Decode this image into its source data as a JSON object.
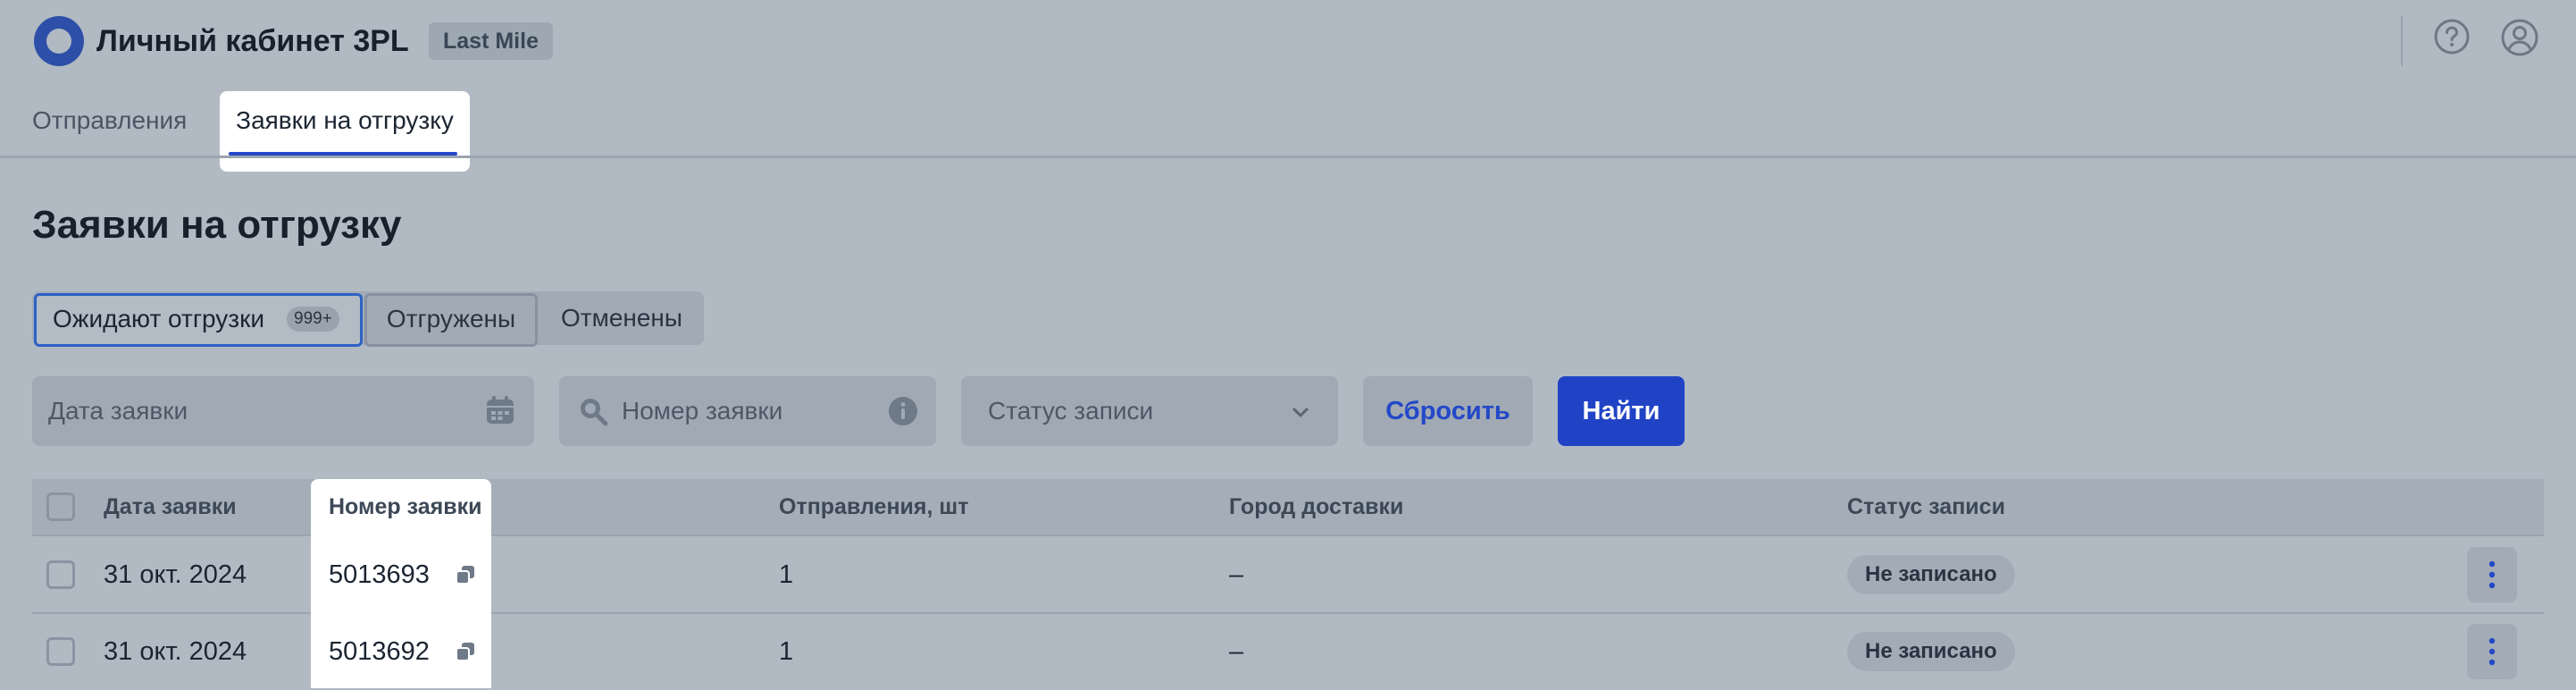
{
  "header": {
    "app_title": "Личный кабинет 3PL",
    "badge": "Last Mile",
    "icons": [
      "help-icon",
      "user-icon"
    ]
  },
  "nav": {
    "tabs": [
      {
        "label": "Отправления",
        "active": false
      },
      {
        "label": "Заявки на отгрузку",
        "active": true
      }
    ]
  },
  "page": {
    "title": "Заявки на отгрузку"
  },
  "segments": [
    {
      "label": "Ожидают отгрузки",
      "count": "999+",
      "selected": true
    },
    {
      "label": "Отгружены",
      "selected": false
    },
    {
      "label": "Отменены",
      "selected": false
    }
  ],
  "filters": {
    "date_placeholder": "Дата заявки",
    "number_placeholder": "Номер заявки",
    "status_placeholder": "Статус записи",
    "reset_label": "Сбросить",
    "find_label": "Найти"
  },
  "table": {
    "columns": [
      "Дата заявки",
      "Номер заявки",
      "Отправления, шт",
      "Город доставки",
      "Статус записи"
    ],
    "rows": [
      {
        "date": "31 окт. 2024",
        "number": "5013693",
        "shipments": "1",
        "city": "–",
        "status": "Не записано"
      },
      {
        "date": "31 окт. 2024",
        "number": "5013692",
        "shipments": "1",
        "city": "–",
        "status": "Не записано"
      }
    ]
  },
  "colors": {
    "accent": "#2043c6",
    "overlay_bg": "#b1bac3",
    "highlight": "#ffffff"
  }
}
